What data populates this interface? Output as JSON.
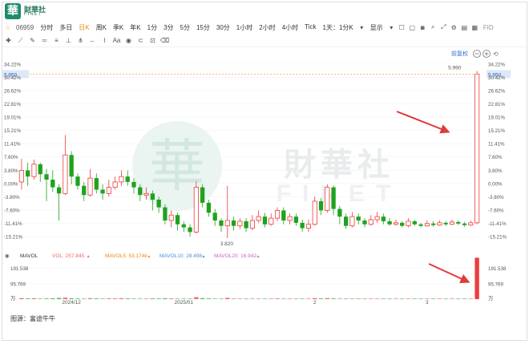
{
  "brand": {
    "logo_char": "華",
    "name_cn": "財華社",
    "name_en": "FINET"
  },
  "toolbar": {
    "symbol": "06959",
    "periods": [
      "分时",
      "多日",
      "日K",
      "周K",
      "季K",
      "年K",
      "1分",
      "3分",
      "5分",
      "15分",
      "30分",
      "1小时",
      "2小时",
      "4小时",
      "Tick"
    ],
    "active_period": "日K",
    "range_select": "1天：1分K",
    "display_label": "显示",
    "fid_label": "FID"
  },
  "watermark": {
    "cn": "財華社",
    "en": "FINET"
  },
  "chart_data": {
    "type": "candlestick",
    "title": "",
    "adjust_label": "前复权",
    "price_axis_ticks": [
      "34.22%",
      "30.42%",
      "26.62%",
      "22.81%",
      "19.01%",
      "15.21%",
      "11.41%",
      "7.60%",
      "3.80%",
      "0.00%",
      "-3.80%",
      "-7.60%",
      "-11.41%",
      "-15.21%"
    ],
    "price_axis_values": [
      34.22,
      30.42,
      26.62,
      22.81,
      19.01,
      15.21,
      11.41,
      7.6,
      3.8,
      0.0,
      -3.8,
      -7.6,
      -11.41,
      -15.21
    ],
    "pct_range": [
      -17.5,
      35.8
    ],
    "base_price": 4.53,
    "current_price_label": "5.950",
    "high_label": "5.990",
    "low_label": "3.820",
    "x_labels": [
      "2024/12",
      "2025/01",
      "2",
      "3"
    ],
    "x_label_index": [
      8,
      26,
      47,
      65
    ],
    "candles": [
      [
        4.55,
        4.7,
        4.85,
        4.45
      ],
      [
        4.7,
        4.62,
        4.8,
        4.5
      ],
      [
        4.62,
        4.78,
        4.84,
        4.58
      ],
      [
        4.78,
        4.65,
        4.8,
        4.55
      ],
      [
        4.65,
        4.58,
        4.72,
        4.3
      ],
      [
        4.58,
        4.48,
        4.7,
        4.42
      ],
      [
        4.48,
        4.4,
        4.52,
        4.05
      ],
      [
        4.4,
        4.9,
        5.16,
        4.38
      ],
      [
        4.9,
        4.62,
        4.95,
        4.52
      ],
      [
        4.62,
        4.5,
        4.66,
        4.45
      ],
      [
        4.5,
        4.38,
        4.55,
        4.3
      ],
      [
        4.38,
        4.6,
        4.72,
        4.36
      ],
      [
        4.6,
        4.45,
        4.66,
        4.4
      ],
      [
        4.45,
        4.4,
        4.52,
        4.32
      ],
      [
        4.4,
        4.48,
        4.58,
        4.36
      ],
      [
        4.48,
        4.55,
        4.62,
        4.45
      ],
      [
        4.55,
        4.62,
        4.7,
        4.5
      ],
      [
        4.62,
        4.55,
        4.7,
        4.5
      ],
      [
        4.55,
        4.48,
        4.6,
        4.4
      ],
      [
        4.48,
        4.38,
        4.52,
        4.3
      ],
      [
        4.38,
        4.4,
        4.48,
        4.32
      ],
      [
        4.4,
        4.32,
        4.44,
        4.18
      ],
      [
        4.32,
        4.22,
        4.36,
        4.15
      ],
      [
        4.22,
        4.05,
        4.26,
        4.0
      ],
      [
        4.05,
        4.12,
        4.18,
        3.96
      ],
      [
        4.12,
        4.0,
        4.15,
        3.92
      ],
      [
        4.0,
        3.96,
        4.04,
        3.9
      ],
      [
        3.96,
        3.9,
        4.0,
        3.84
      ],
      [
        3.9,
        4.48,
        4.56,
        3.88
      ],
      [
        4.48,
        4.28,
        4.52,
        4.22
      ],
      [
        4.28,
        4.15,
        4.32,
        4.1
      ],
      [
        4.15,
        4.05,
        4.2,
        3.98
      ],
      [
        4.05,
        3.98,
        4.08,
        3.9
      ],
      [
        3.98,
        4.05,
        4.5,
        3.82
      ],
      [
        4.05,
        3.98,
        4.1,
        3.92
      ],
      [
        3.98,
        4.04,
        4.08,
        3.94
      ],
      [
        4.04,
        3.95,
        4.08,
        3.9
      ],
      [
        3.95,
        4.05,
        4.12,
        3.92
      ],
      [
        4.05,
        4.1,
        4.18,
        4.02
      ],
      [
        4.1,
        4.0,
        4.15,
        3.96
      ],
      [
        4.0,
        4.08,
        4.14,
        3.98
      ],
      [
        4.08,
        4.18,
        4.22,
        4.04
      ],
      [
        4.18,
        4.05,
        4.22,
        4.0
      ],
      [
        4.05,
        4.1,
        4.14,
        4.0
      ],
      [
        4.1,
        4.02,
        4.14,
        3.98
      ],
      [
        4.02,
        3.95,
        4.06,
        3.9
      ],
      [
        3.95,
        4.0,
        4.06,
        3.9
      ],
      [
        4.0,
        4.3,
        4.36,
        3.98
      ],
      [
        4.3,
        4.18,
        4.34,
        4.12
      ],
      [
        4.18,
        4.48,
        4.52,
        4.15
      ],
      [
        4.48,
        4.2,
        4.5,
        4.12
      ],
      [
        4.2,
        4.1,
        4.24,
        4.0
      ],
      [
        4.1,
        3.98,
        4.14,
        3.94
      ],
      [
        3.98,
        4.1,
        4.16,
        3.96
      ],
      [
        4.1,
        4.05,
        4.14,
        4.0
      ],
      [
        4.05,
        4.0,
        4.08,
        3.96
      ],
      [
        4.0,
        4.06,
        4.12,
        3.98
      ],
      [
        4.06,
        4.1,
        4.16,
        4.02
      ],
      [
        4.1,
        4.04,
        4.14,
        4.0
      ],
      [
        4.04,
        4.0,
        4.08,
        3.98
      ],
      [
        4.0,
        4.02,
        4.06,
        3.98
      ],
      [
        4.02,
        3.98,
        4.04,
        3.96
      ],
      [
        3.98,
        4.04,
        4.08,
        3.96
      ],
      [
        4.04,
        4.0,
        4.06,
        3.98
      ],
      [
        4.0,
        3.98,
        4.02,
        3.96
      ],
      [
        3.98,
        4.01,
        4.05,
        3.97
      ],
      [
        4.01,
        3.99,
        4.04,
        3.97
      ],
      [
        3.99,
        4.02,
        4.05,
        3.98
      ],
      [
        4.02,
        4.0,
        4.04,
        3.98
      ],
      [
        4.0,
        4.03,
        4.06,
        3.99
      ],
      [
        4.03,
        4.01,
        4.05,
        3.99
      ],
      [
        4.01,
        3.99,
        4.03,
        3.97
      ],
      [
        3.99,
        4.02,
        4.05,
        3.98
      ],
      [
        4.02,
        5.95,
        5.99,
        4.0
      ]
    ],
    "volume": {
      "legend": [
        {
          "label": "MAVOL",
          "color": "#333333"
        },
        {
          "label": "VOL: 257.845",
          "color": "#f06666"
        },
        {
          "label": "MAVOL5: 53.174k",
          "color": "#e8891a"
        },
        {
          "label": "MAVOL10: 28.498",
          "color": "#4a90d9"
        },
        {
          "label": "MAVOL20: 16.942",
          "color": "#d060c8"
        }
      ],
      "axis_ticks": [
        "191.538",
        "95.769",
        "万"
      ],
      "axis_values": [
        191.538,
        95.769
      ],
      "max": 230,
      "values": [
        6,
        4,
        5,
        3,
        4,
        5,
        7,
        9,
        5,
        4,
        3,
        5,
        4,
        3,
        4,
        4,
        5,
        4,
        3,
        3,
        3,
        4,
        4,
        5,
        4,
        3,
        3,
        3,
        12,
        6,
        4,
        3,
        3,
        8,
        3,
        3,
        3,
        3,
        3,
        3,
        3,
        4,
        3,
        3,
        3,
        3,
        3,
        6,
        4,
        6,
        4,
        3,
        3,
        3,
        3,
        3,
        3,
        3,
        3,
        3,
        3,
        3,
        3,
        3,
        3,
        3,
        3,
        3,
        3,
        3,
        3,
        3,
        3,
        258
      ]
    }
  },
  "arrows": {
    "color": "#e03a3a"
  },
  "colors": {
    "up": "#ef3b3b",
    "down": "#1fa21f",
    "price_line": "#f0a050",
    "price_tag_bg": "#2f7de1"
  },
  "footer": {
    "source": "图源：富途牛牛"
  }
}
